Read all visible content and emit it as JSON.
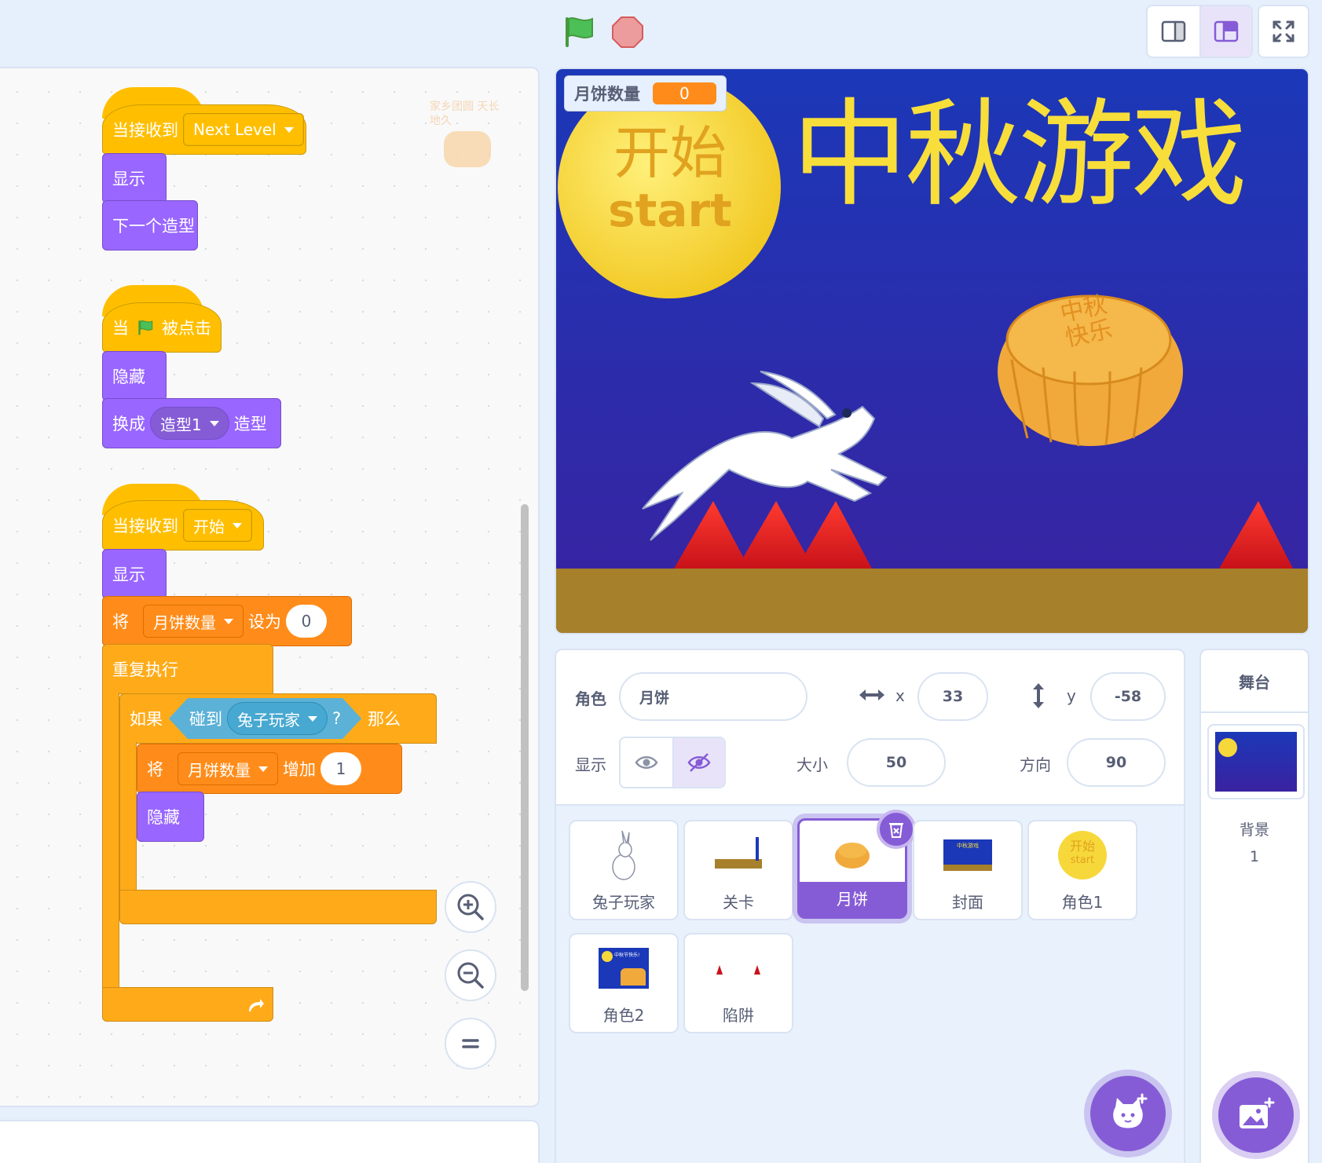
{
  "controls": {
    "green_flag": "green-flag-icon",
    "stop": "stop-icon"
  },
  "code": {
    "script1": {
      "hat_label": "当接收到",
      "message": "Next Level",
      "show": "显示",
      "next_costume": "下一个造型"
    },
    "script2": {
      "hat_when": "当",
      "hat_clicked": "被点击",
      "hide": "隐藏",
      "switch_label": "换成",
      "costume": "造型1",
      "switch_suffix": "造型"
    },
    "script3": {
      "hat_label": "当接收到",
      "message": "开始",
      "show": "显示",
      "set_label": "将",
      "variable": "月饼数量",
      "set_to": "设为",
      "set_value": "0",
      "forever": "重复执行",
      "if_label": "如果",
      "touching": "碰到",
      "touch_target": "兔子玩家",
      "question": "?",
      "then": "那么",
      "change_label": "将",
      "change_variable": "月饼数量",
      "change_by": "增加",
      "change_value": "1",
      "hide": "隐藏"
    },
    "floating_sprite_text": "家乡团圆 天长地久"
  },
  "stage": {
    "monitor_label": "月饼数量",
    "monitor_value": "0",
    "title": "中秋游戏",
    "moon_text_cn": "开始",
    "moon_text_en": "start",
    "mooncake_text_1": "中秋",
    "mooncake_text_2": "快乐"
  },
  "sprite_info": {
    "sprite_label": "角色",
    "sprite_name": "月饼",
    "x_label": "x",
    "x_value": "33",
    "y_label": "y",
    "y_value": "-58",
    "show_label": "显示",
    "size_label": "大小",
    "size_value": "50",
    "direction_label": "方向",
    "direction_value": "90"
  },
  "sprites": [
    {
      "name": "兔子玩家"
    },
    {
      "name": "关卡"
    },
    {
      "name": "月饼",
      "selected": true
    },
    {
      "name": "封面",
      "thumb_text": "中秋游戏"
    },
    {
      "name": "角色1",
      "thumb_text_cn": "开始",
      "thumb_text_en": "start"
    },
    {
      "name": "角色2",
      "thumb_text": "中秋节快乐!"
    },
    {
      "name": "陷阱"
    }
  ],
  "stage_panel": {
    "header": "舞台",
    "backdrops_label": "背景",
    "backdrops_count": "1"
  },
  "colors": {
    "events": "#ffbf00",
    "looks": "#9966ff",
    "variables": "#ff8c1a",
    "control": "#ffab19",
    "sensing": "#5cb1d6",
    "accent": "#855cd6"
  }
}
